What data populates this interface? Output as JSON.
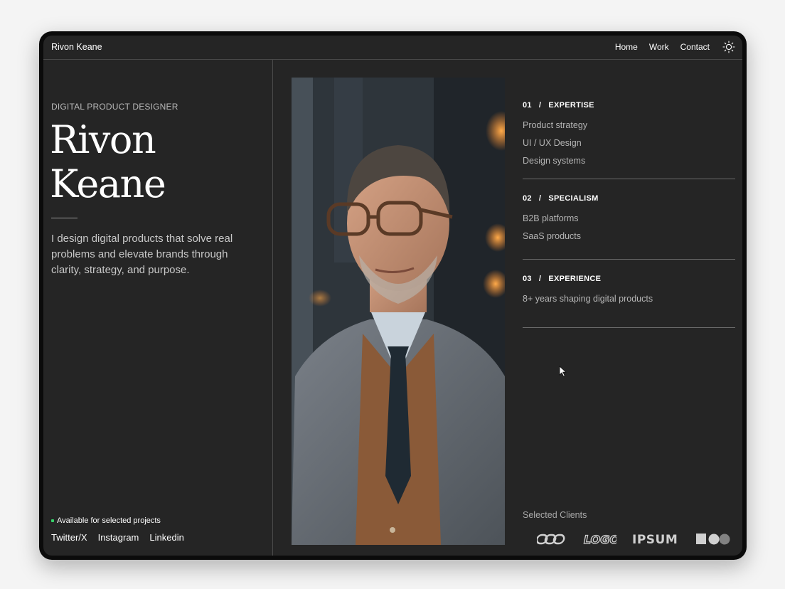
{
  "header": {
    "brand": "Rivon Keane",
    "nav": [
      "Home",
      "Work",
      "Contact"
    ],
    "theme_icon": "sun-icon"
  },
  "hero": {
    "role": "DIGITAL PRODUCT DESIGNER",
    "name_line1": "Rivon",
    "name_line2": "Keane",
    "intro": "I design digital products that solve real problems and elevate brands through clarity, strategy, and purpose."
  },
  "footer_left": {
    "availability": "Available for selected projects",
    "socials": [
      "Twitter/X",
      "Instagram",
      "Linkedin"
    ]
  },
  "portrait": {
    "icon": "portrait-photo"
  },
  "sections": [
    {
      "number": "01",
      "separator": "/",
      "title": "EXPERTISE",
      "items": [
        "Product strategy",
        "UI / UX Design",
        "Design systems"
      ]
    },
    {
      "number": "02",
      "separator": "/",
      "title": "SPECIALISM",
      "items": [
        "B2B platforms",
        "SaaS products"
      ]
    },
    {
      "number": "03",
      "separator": "/",
      "title": "EXPERIENCE",
      "items": [
        "8+ years shaping digital products"
      ]
    }
  ],
  "clients": {
    "label": "Selected Clients",
    "logos": [
      "chain-logo",
      "LOGO",
      "IPSUM",
      "shapes-logo"
    ]
  },
  "colors": {
    "background": "#252525",
    "availability_dot": "#36d26a",
    "accent_light": "#ff8a2a"
  }
}
